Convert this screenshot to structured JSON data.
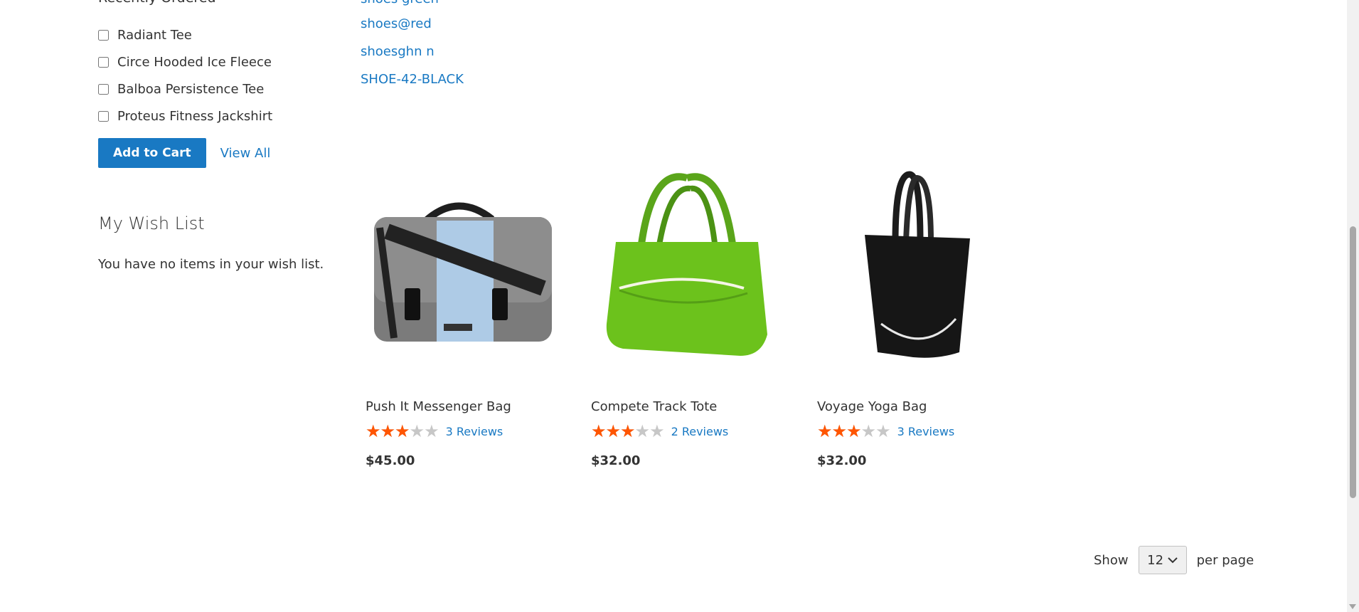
{
  "sidebar": {
    "partial_title": "Recently Ordered",
    "compare_items": [
      {
        "label": "Radiant Tee"
      },
      {
        "label": "Circe Hooded Ice Fleece"
      },
      {
        "label": "Balboa Persistence Tee"
      },
      {
        "label": "Proteus Fitness Jackshirt"
      }
    ],
    "add_to_cart_label": "Add to Cart",
    "view_all_label": "View All",
    "wishlist_title": "My Wish List",
    "wishlist_empty": "You have no items in your wish list."
  },
  "tags": [
    {
      "label": "shoes green"
    },
    {
      "label": "shoes@red"
    },
    {
      "label": "shoesghn n"
    },
    {
      "label": "SHOE-42-BLACK"
    }
  ],
  "products": [
    {
      "name": "Push It Messenger Bag",
      "rating_percent": 60,
      "reviews": "3 Reviews",
      "price": "$45.00",
      "image": "gray-messenger-bag"
    },
    {
      "name": "Compete Track Tote",
      "rating_percent": 60,
      "reviews": "2 Reviews",
      "price": "$32.00",
      "image": "green-duffle-bag"
    },
    {
      "name": "Voyage Yoga Bag",
      "rating_percent": 60,
      "reviews": "3 Reviews",
      "price": "$32.00",
      "image": "black-tote-bag"
    }
  ],
  "toolbar": {
    "show_label": "Show",
    "limiter_value": "12",
    "per_page_label": "per page"
  },
  "colors": {
    "link": "#1979c3",
    "button": "#1979c3",
    "star_filled": "#ff5501",
    "star_empty": "#c7c7c7"
  }
}
